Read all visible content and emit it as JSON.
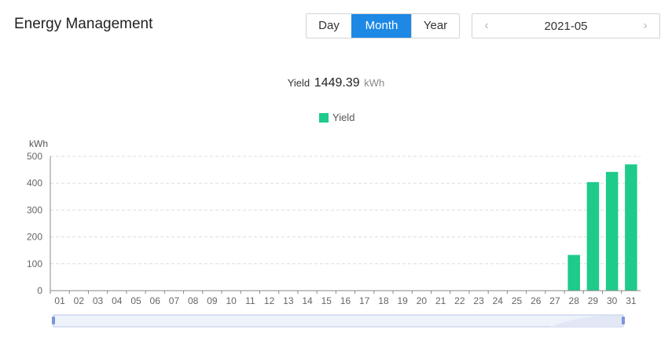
{
  "header": {
    "title": "Energy Management"
  },
  "period_tabs": [
    {
      "label": "Day",
      "active": false
    },
    {
      "label": "Month",
      "active": true
    },
    {
      "label": "Year",
      "active": false
    }
  ],
  "date_picker": {
    "value": "2021-05",
    "prev_icon": "chevron-left-icon",
    "next_icon": "chevron-right-icon"
  },
  "summary": {
    "label": "Yield",
    "value": "1449.39",
    "unit": "kWh"
  },
  "colors": {
    "accent": "#1e88e5",
    "series": "#1ecb8a"
  },
  "chart_data": {
    "type": "bar",
    "categories": [
      "01",
      "02",
      "03",
      "04",
      "05",
      "06",
      "07",
      "08",
      "09",
      "10",
      "11",
      "12",
      "13",
      "14",
      "15",
      "16",
      "17",
      "18",
      "19",
      "20",
      "21",
      "22",
      "23",
      "24",
      "25",
      "26",
      "27",
      "28",
      "29",
      "30",
      "31"
    ],
    "series": [
      {
        "name": "Yield",
        "values": [
          0,
          0,
          0,
          0,
          0,
          0,
          0,
          0,
          0,
          0,
          0,
          0,
          0,
          0,
          0,
          0,
          0,
          0,
          0,
          0,
          0,
          0,
          0,
          0,
          0,
          0,
          0,
          133,
          404,
          442,
          470
        ]
      }
    ],
    "ylabel": "kWh",
    "ylim": [
      0,
      500
    ],
    "yticks": [
      0,
      100,
      200,
      300,
      400,
      500
    ],
    "grid": true,
    "legend": "top-center"
  }
}
